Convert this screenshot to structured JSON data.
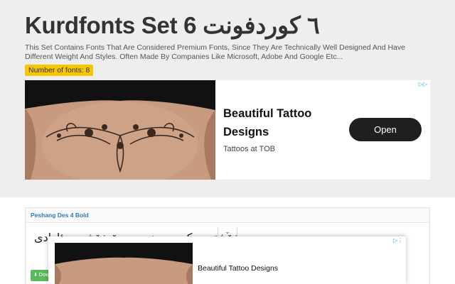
{
  "header": {
    "title": "Kurdfonts Set 6 ٦ كوردفونت",
    "description": "This Set Contains Fonts That Are Considered Premium Fonts, Since They Are Technically Well Designed And Have Different Weight And Styles. Often Made By Companies Like Microsoft, Adobe And Google Etc...",
    "font_count": "Number of fonts: 8"
  },
  "ad_banner": {
    "headline": "Beautiful Tattoo Designs",
    "sub": "Tattoos at TOB",
    "cta": "Open",
    "adchoices_icon": "▷▷"
  },
  "font_card": {
    "name": "Peshang Des 4 Bold",
    "preview": "خۆشترین کوردی بنووسە بۆ خۆشی و ئازادی",
    "collapse_icon": "⌄",
    "download_label": "⬇ Download"
  },
  "anchor_ad": {
    "title": "Beautiful Tattoo Designs",
    "adchoices_icon": "▷⋮"
  }
}
